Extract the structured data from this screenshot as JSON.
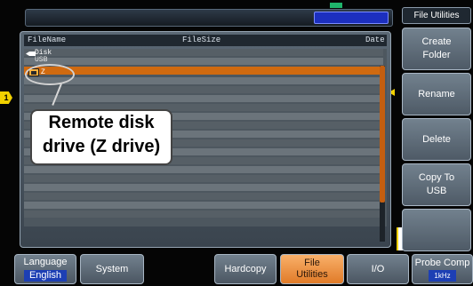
{
  "file_list": {
    "header": {
      "name": "FileName",
      "size": "FileSize",
      "date": "Date"
    },
    "parent_dir": "Disk",
    "disk_path": "USB",
    "selected_item": "Z"
  },
  "callout": {
    "line1": "Remote disk",
    "line2": "drive (Z drive)"
  },
  "side_menu": {
    "title": "File Utilities",
    "buttons": [
      {
        "label": "Create\nFolder"
      },
      {
        "label": "Rename"
      },
      {
        "label": "Delete"
      },
      {
        "label": "Copy To\nUSB"
      },
      {
        "label": ""
      }
    ]
  },
  "bottom_menu": {
    "language": {
      "label": "Language",
      "value": "English"
    },
    "system": "System",
    "hardcopy": "Hardcopy",
    "file_utilities": {
      "line1": "File",
      "line2": "Utilities"
    },
    "io": "I/O",
    "probe_comp": {
      "label": "Probe Comp",
      "value": "1kHz"
    }
  },
  "markers": {
    "channel": "1"
  },
  "colors": {
    "selection": "#d06a10",
    "active_button": "#e07b28",
    "channel_marker": "#f2d100",
    "status_blue": "#1c2fbf"
  }
}
